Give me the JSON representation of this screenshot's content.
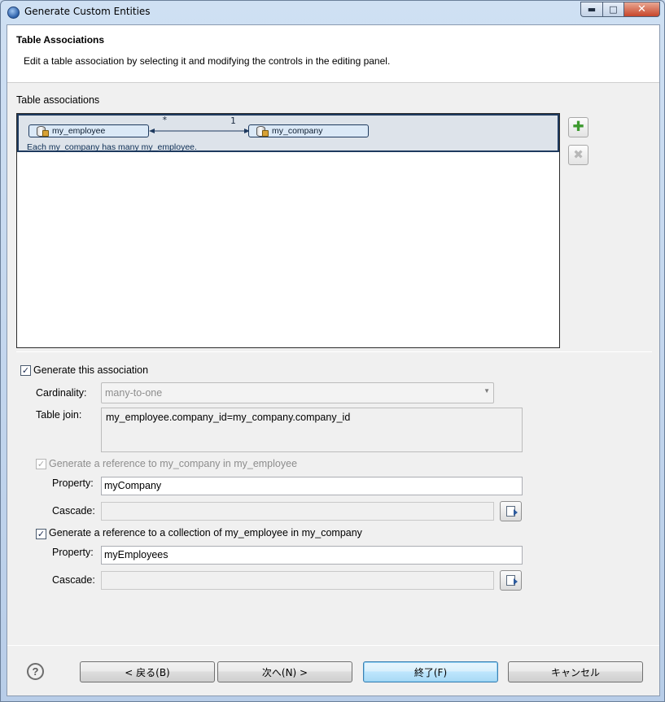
{
  "window": {
    "title": "Generate Custom Entities",
    "controls": {
      "minimize": "▬",
      "maximize": "□",
      "close": "✕"
    }
  },
  "header": {
    "title": "Table Associations",
    "description": "Edit a table association by selecting it and modifying the controls in the editing panel."
  },
  "associations": {
    "label": "Table associations",
    "items": [
      {
        "source": "my_employee",
        "target": "my_company",
        "source_cardinality": "*",
        "target_cardinality": "1",
        "description": "Each my_company has many my_employee."
      }
    ],
    "add_icon": "plus-icon",
    "remove_icon": "delete-icon"
  },
  "editor": {
    "generate_label": "Generate this association",
    "generate_checked": true,
    "cardinality_label": "Cardinality:",
    "cardinality_value": "many-to-one",
    "table_join_label": "Table join:",
    "table_join_value": "my_employee.company_id=my_company.company_id",
    "ref1": {
      "label": "Generate a reference to my_company in my_employee",
      "checked": true,
      "disabled": true,
      "property_label": "Property:",
      "property_value": "myCompany",
      "cascade_label": "Cascade:",
      "cascade_value": ""
    },
    "ref2": {
      "label": "Generate a reference to a collection of my_employee in my_company",
      "checked": true,
      "property_label": "Property:",
      "property_value": "myEmployees",
      "cascade_label": "Cascade:",
      "cascade_value": ""
    }
  },
  "footer": {
    "help": "?",
    "back": "< 戻る(B)",
    "next": "次へ(N) >",
    "finish": "終了(F)",
    "cancel": "キャンセル"
  }
}
